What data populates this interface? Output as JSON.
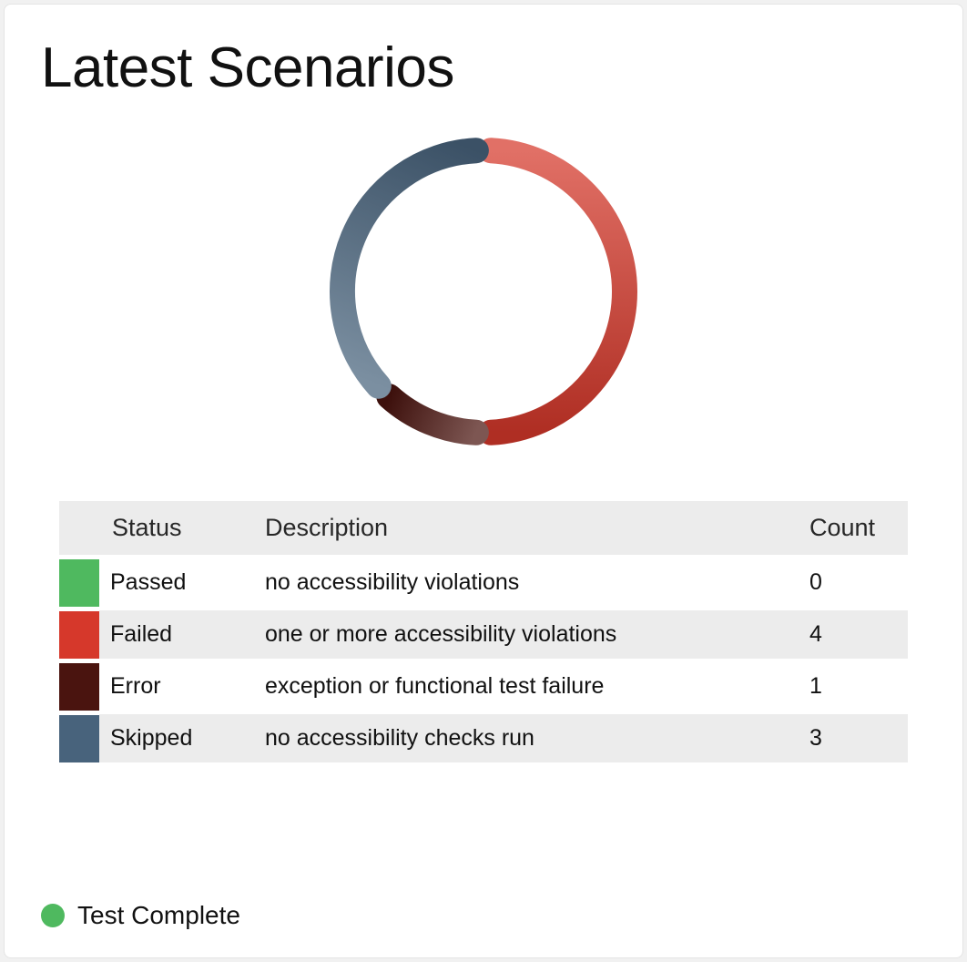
{
  "title": "Latest Scenarios",
  "colors": {
    "passed": "#4fb95f",
    "failed": "#d6382b",
    "error": "#4a140f",
    "skipped": "#48637c"
  },
  "columns": {
    "status": "Status",
    "description": "Description",
    "count": "Count"
  },
  "rows": [
    {
      "status": "Passed",
      "description": "no accessibility violations",
      "count": 0,
      "colorKey": "passed"
    },
    {
      "status": "Failed",
      "description": "one or more accessibility violations",
      "count": 4,
      "colorKey": "failed"
    },
    {
      "status": "Error",
      "description": "exception or functional test failure",
      "count": 1,
      "colorKey": "error"
    },
    {
      "status": "Skipped",
      "description": "no accessibility checks run",
      "count": 3,
      "colorKey": "skipped"
    }
  ],
  "footer": {
    "label": "Test Complete",
    "dotColorKey": "passed"
  },
  "chart_data": {
    "type": "pie",
    "title": "Latest Scenarios",
    "series": [
      {
        "name": "Passed",
        "value": 0,
        "color": "#4fb95f"
      },
      {
        "name": "Failed",
        "value": 4,
        "color": "#d6382b"
      },
      {
        "name": "Error",
        "value": 1,
        "color": "#4a140f"
      },
      {
        "name": "Skipped",
        "value": 3,
        "color": "#48637c"
      }
    ],
    "note": "donut chart; segments rendered with radial gradient lightening toward center"
  }
}
